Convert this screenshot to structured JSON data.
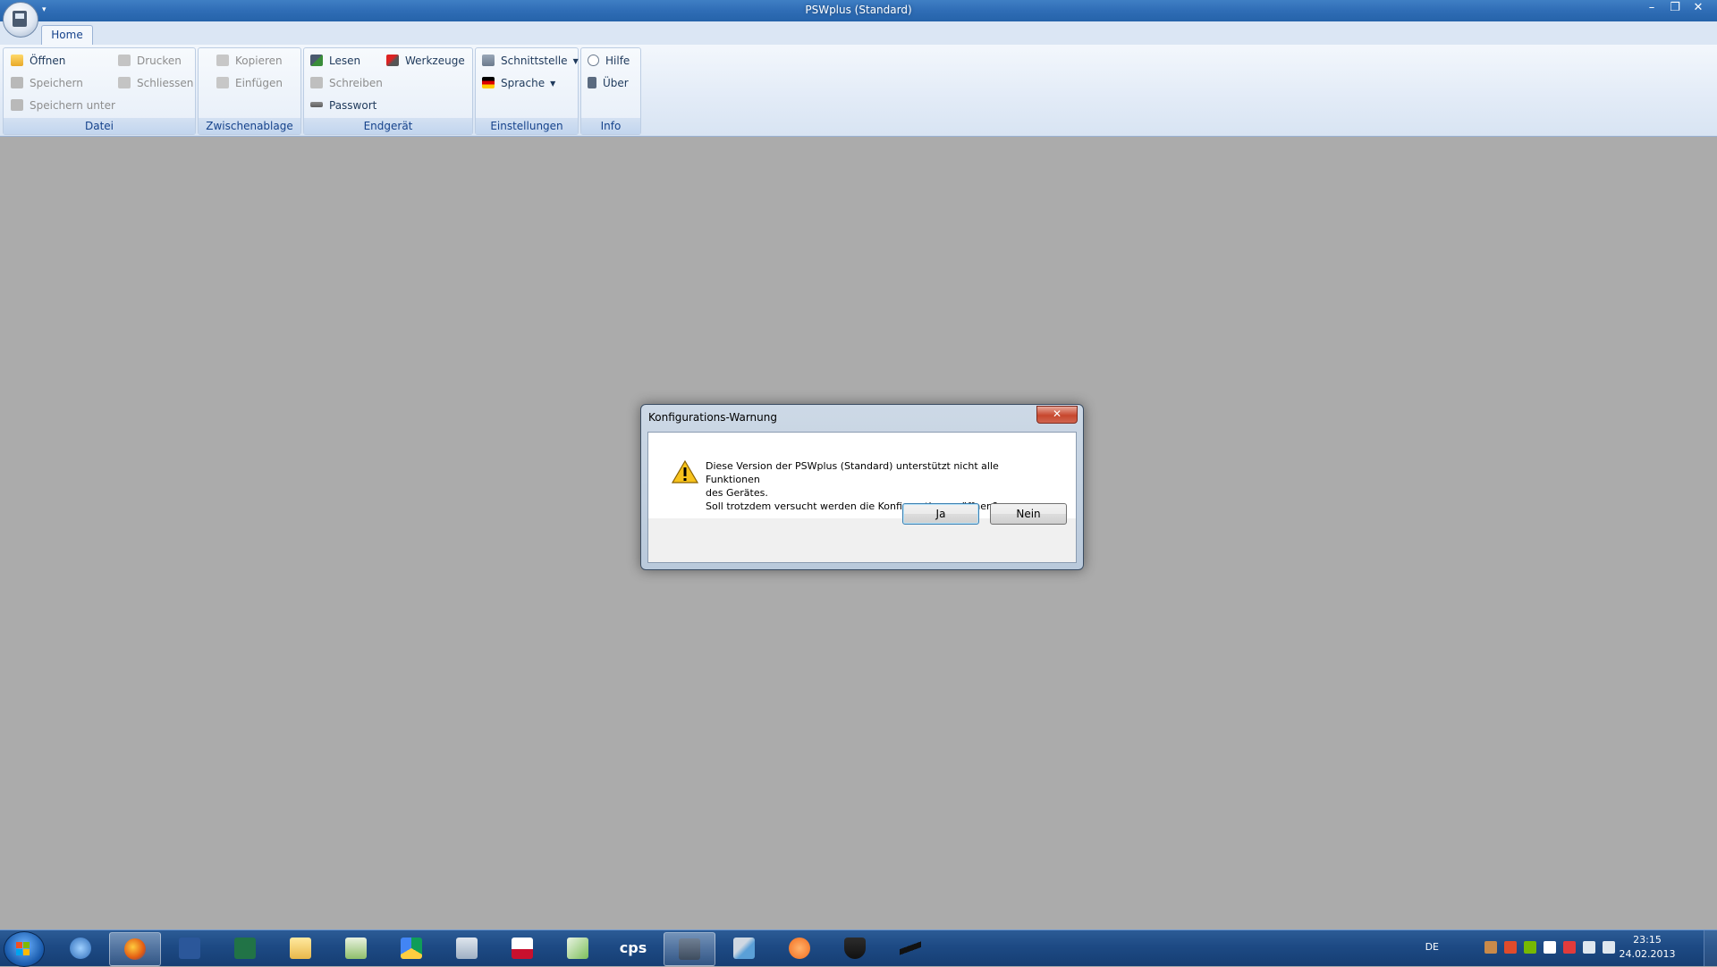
{
  "window": {
    "title": "PSWplus (Standard)",
    "controls": {
      "minimize": "–",
      "restore": "❐",
      "close": "✕"
    }
  },
  "ribbon": {
    "tabs": [
      {
        "label": "Home"
      }
    ],
    "groups": {
      "datei": {
        "label": "Datei",
        "items": {
          "oeffnen": "Öffnen",
          "speichern": "Speichern",
          "speichern_unter": "Speichern unter",
          "drucken": "Drucken",
          "schliessen": "Schliessen"
        }
      },
      "zwischenablage": {
        "label": "Zwischenablage",
        "items": {
          "kopieren": "Kopieren",
          "einfuegen": "Einfügen"
        }
      },
      "endgeraet": {
        "label": "Endgerät",
        "items": {
          "lesen": "Lesen",
          "schreiben": "Schreiben",
          "passwort": "Passwort",
          "werkzeuge": "Werkzeuge"
        }
      },
      "einstellungen": {
        "label": "Einstellungen",
        "items": {
          "schnittstelle": "Schnittstelle",
          "sprache": "Sprache"
        }
      },
      "info": {
        "label": "Info",
        "items": {
          "hilfe": "Hilfe",
          "ueber": "Über"
        }
      }
    }
  },
  "dialog": {
    "title": "Konfigurations-Warnung",
    "close": "✕",
    "message_lines": [
      "Diese Version der PSWplus (Standard) unterstützt nicht alle Funktionen",
      "des Gerätes.",
      "Soll trotzdem versucht werden die Konfiguration zu öffnen?"
    ],
    "buttons": {
      "yes": "Ja",
      "no": "Nein"
    }
  },
  "taskbar": {
    "items": [
      {
        "icon": "thunderbird-icon"
      },
      {
        "icon": "firefox-icon"
      },
      {
        "icon": "word-icon"
      },
      {
        "icon": "excel-icon"
      },
      {
        "icon": "explorer-folder-icon"
      },
      {
        "icon": "checkmark-app-icon"
      },
      {
        "icon": "google-drive-icon"
      },
      {
        "icon": "calculator-icon"
      },
      {
        "icon": "pdf-icon"
      },
      {
        "icon": "mail-icon"
      },
      {
        "icon": "cps-icon",
        "label": "cps"
      },
      {
        "icon": "pswplus-icon"
      },
      {
        "icon": "network-tool-icon"
      },
      {
        "icon": "avast-icon"
      },
      {
        "icon": "shield-app-icon"
      },
      {
        "icon": "bird-app-icon"
      }
    ],
    "tray": {
      "language": "DE",
      "time": "23:15",
      "date": "24.02.2013"
    }
  },
  "colors": {
    "titlebar": "#2f6db6",
    "workspace": "#ababab",
    "ribbon_group_label": "#15428b",
    "taskbar": "#1d4a84"
  }
}
